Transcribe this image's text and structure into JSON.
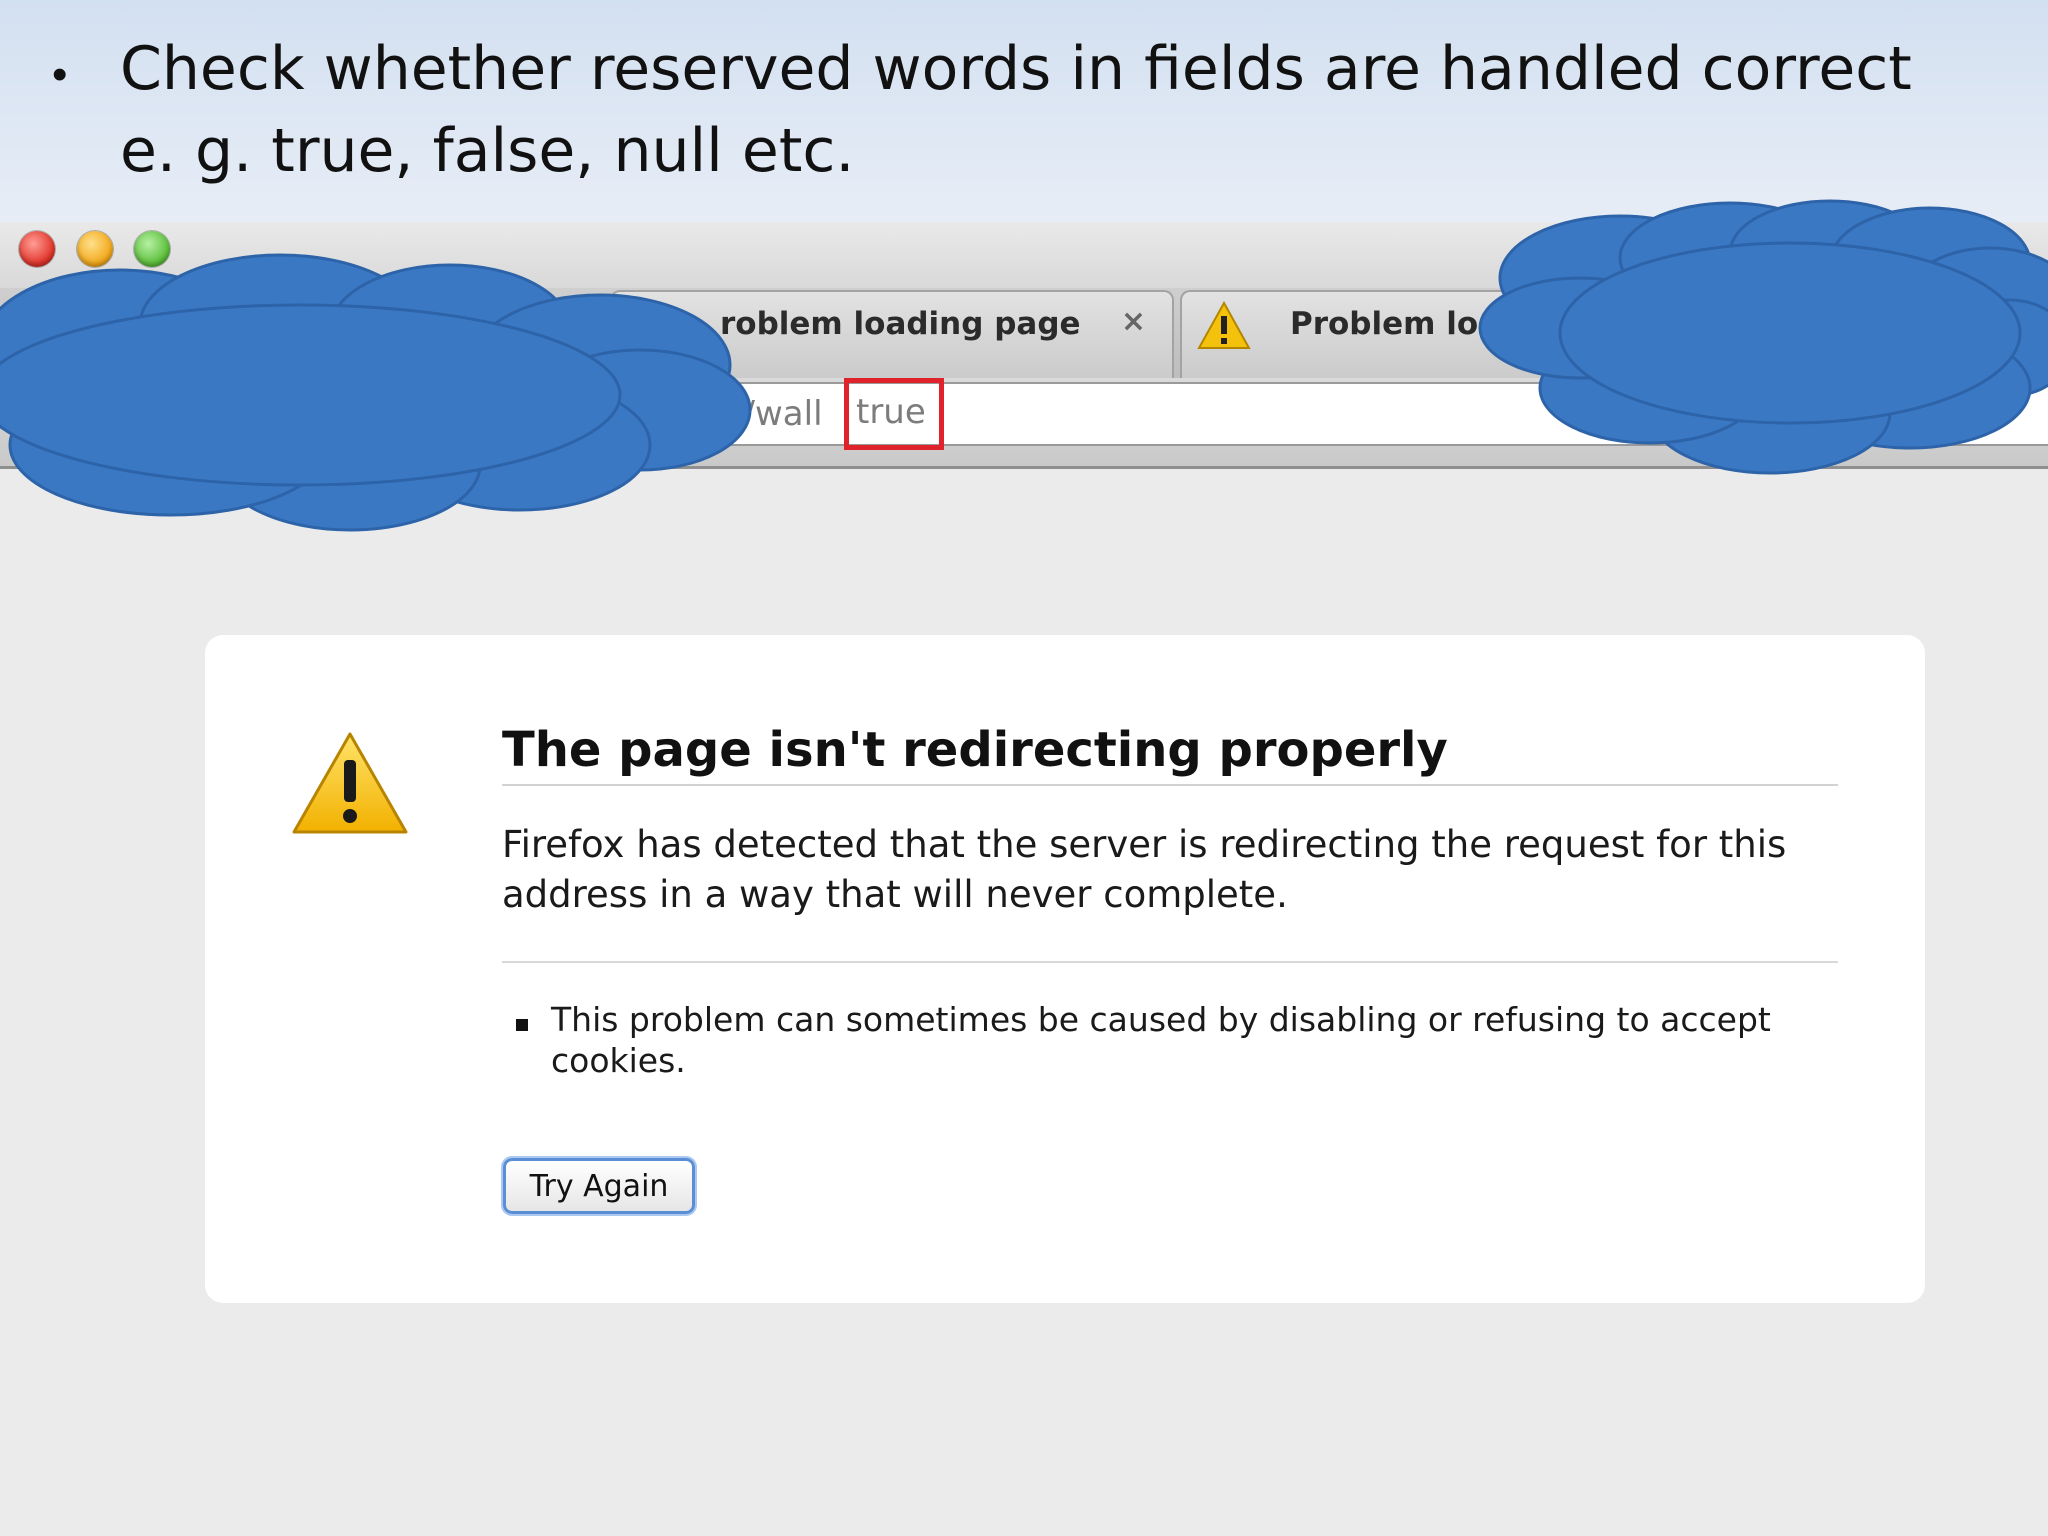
{
  "slide": {
    "bullet_symbol": "•",
    "bullet_text": "Check whether reserved words in fields are handled correct e. g. true, false, null etc."
  },
  "browser": {
    "tabs": [
      {
        "label": "roblem loading page",
        "close_symbol": "×"
      },
      {
        "label": "Problem loa",
        "icon": "warning-icon"
      }
    ],
    "url": {
      "visible_path": "n/wall",
      "highlighted_value": "true",
      "highlight_color": "#e0222a"
    }
  },
  "error_page": {
    "title": "The page isn't redirecting properly",
    "description": "Firefox has detected that the server is redirecting the request for this address in a way that will never complete.",
    "hint": "This problem can sometimes be caused by disabling or refusing to accept cookies.",
    "button_label": "Try Again",
    "icon": "warning-icon"
  },
  "redaction_color": "#3b78c4"
}
